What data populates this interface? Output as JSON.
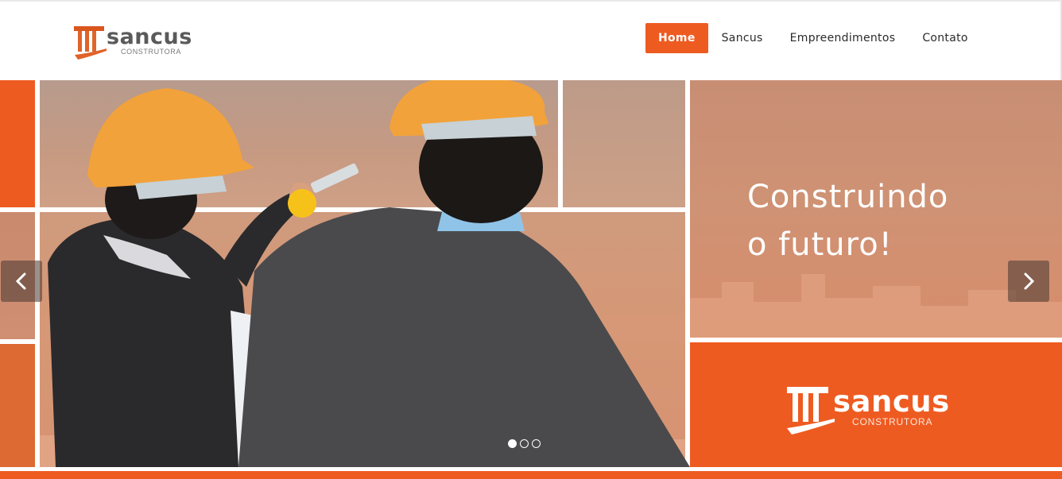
{
  "brand": {
    "name": "sancus",
    "tagline": "CONSTRUTORA",
    "accent": "#ee5b21",
    "text_color": "#5a5a5a"
  },
  "nav": {
    "items": [
      {
        "label": "Home",
        "active": true
      },
      {
        "label": "Sancus",
        "active": false
      },
      {
        "label": "Empreendimentos",
        "active": false
      },
      {
        "label": "Contato",
        "active": false
      }
    ]
  },
  "hero": {
    "slogan_line1": "Construindo",
    "slogan_line2": "o futuro!",
    "logo_name": "sancus",
    "logo_tagline": "CONSTRUTORA",
    "prev_icon": "chevron-left-icon",
    "next_icon": "chevron-right-icon",
    "slides_total": 3,
    "slide_active": 1
  }
}
